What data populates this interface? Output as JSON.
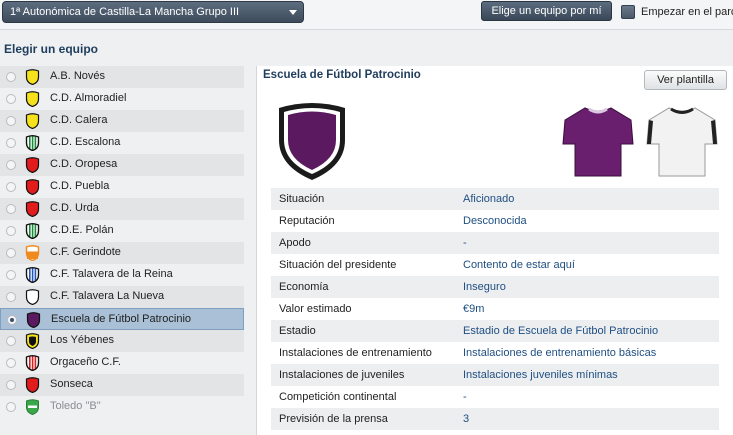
{
  "topbar": {
    "league": "1ª Autonómica de Castilla-La Mancha Grupo III",
    "choose_button": "Elige un equipo por mí",
    "start_label": "Empezar en el parc"
  },
  "heading": "Elegir un equipo",
  "teams": [
    {
      "name": "A.B. Novés",
      "crest": "yellow"
    },
    {
      "name": "C.D. Almoradiel",
      "crest": "yellow"
    },
    {
      "name": "C.D. Calera",
      "crest": "yellow"
    },
    {
      "name": "C.D. Escalona",
      "crest": "green-stripes"
    },
    {
      "name": "C.D. Oropesa",
      "crest": "red"
    },
    {
      "name": "C.D. Puebla",
      "crest": "red"
    },
    {
      "name": "C.D. Urda",
      "crest": "red"
    },
    {
      "name": "C.D.E. Polán",
      "crest": "green-stripes"
    },
    {
      "name": "C.F. Gerindote",
      "crest": "orange"
    },
    {
      "name": "C.F. Talavera de la Reina",
      "crest": "blue-stripes"
    },
    {
      "name": "C.F. Talavera La Nueva",
      "crest": "white"
    },
    {
      "name": "Escuela de Fútbol Patrocinio",
      "crest": "purple"
    },
    {
      "name": "Los Yébenes",
      "crest": "black-yellow"
    },
    {
      "name": "Orgaceño C.F.",
      "crest": "red-stripes"
    },
    {
      "name": "Sonseca",
      "crest": "red-round"
    },
    {
      "name": "Toledo \"B\"",
      "crest": "green-badge"
    }
  ],
  "selected_index": 11,
  "club": {
    "name": "Escuela de Fútbol Patrocinio",
    "squad_button": "Ver plantilla",
    "home_shirt_color": "#6a1f6e",
    "away_shirt_color": "#f2f2f2",
    "crest_color": "#5b1a5f"
  },
  "info": [
    {
      "label": "Situación",
      "value": "Aficionado"
    },
    {
      "label": "Reputación",
      "value": "Desconocida"
    },
    {
      "label": "Apodo",
      "value": "-"
    },
    {
      "label": "Situación del presidente",
      "value": "Contento de estar aquí"
    },
    {
      "label": "Economía",
      "value": "Inseguro"
    },
    {
      "label": "Valor estimado",
      "value": "€9m"
    },
    {
      "label": "Estadio",
      "value": "Estadio de Escuela de Fútbol Patrocinio"
    },
    {
      "label": "Instalaciones de entrenamiento",
      "value": "Instalaciones de entrenamiento básicas"
    },
    {
      "label": "Instalaciones de juveniles",
      "value": "Instalaciones juveniles mínimas"
    },
    {
      "label": "Competición continental",
      "value": "-"
    },
    {
      "label": "Previsión de la prensa",
      "value": "3"
    }
  ]
}
